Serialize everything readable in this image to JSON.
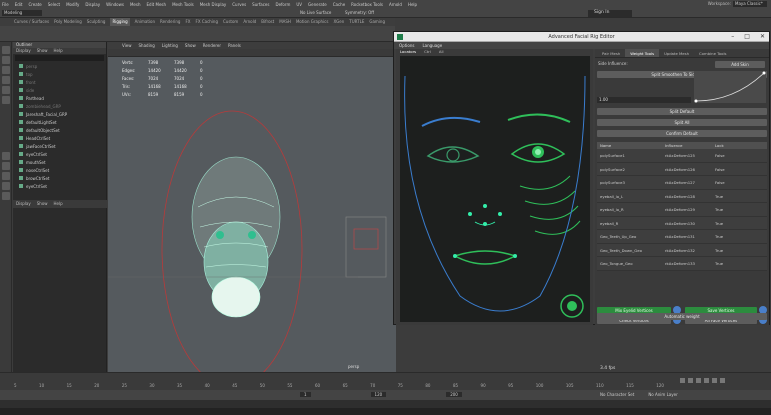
{
  "menubar": {
    "items": [
      "File",
      "Edit",
      "Create",
      "Select",
      "Modify",
      "Display",
      "Windows",
      "Mesh",
      "Edit Mesh",
      "Mesh Tools",
      "Mesh Display",
      "Curves",
      "Surfaces",
      "Deform",
      "UV",
      "Generate",
      "Cache",
      "Rocketbox Tools",
      "Arnold",
      "Help"
    ],
    "workspace_label": "Workspace:",
    "workspace_value": "Maya Classic*"
  },
  "statusline": {
    "mode": "Modeling",
    "sign_in": "Sign In",
    "live_surface": "No Live Surface",
    "symmetry": "Symmetry: Off"
  },
  "shelf_tabs": {
    "items": [
      "Curves / Surfaces",
      "Poly Modeling",
      "Sculpting",
      "Rigging",
      "Animation",
      "Rendering",
      "FX",
      "FX Caching",
      "Custom",
      "Arnold",
      "Bifrost",
      "MASH",
      "Motion Graphics",
      "XGen",
      "TURTLE",
      "Gaming"
    ],
    "active": 3
  },
  "outliner": {
    "title": "Outliner",
    "menu": [
      "Display",
      "Show",
      "Help"
    ],
    "items": [
      {
        "label": "persp",
        "dim": true
      },
      {
        "label": "top",
        "dim": true
      },
      {
        "label": "front",
        "dim": true
      },
      {
        "label": "side",
        "dim": true
      },
      {
        "label": "Parthead",
        "dim": false
      },
      {
        "label": "zombiehead_GRP",
        "dim": true
      },
      {
        "label": "Jareshaft_Facial_GRP",
        "dim": false
      },
      {
        "label": "defaultLightSet",
        "dim": false
      },
      {
        "label": "defaultObjectSet",
        "dim": false
      },
      {
        "label": "HeadCtrlSet",
        "dim": false
      },
      {
        "label": "jawFaceCtrlSet",
        "dim": false
      },
      {
        "label": "eyeCtrlSet",
        "dim": false
      },
      {
        "label": "mouthSet",
        "dim": false
      },
      {
        "label": "noseCtrlSet",
        "dim": false
      },
      {
        "label": "browCtrlSet",
        "dim": false
      },
      {
        "label": "eyeCtrlSet",
        "dim": false
      }
    ],
    "lower_menu": [
      "Display",
      "Show",
      "Help"
    ]
  },
  "viewport": {
    "menu": [
      "View",
      "Shading",
      "Lighting",
      "Show",
      "Renderer",
      "Panels"
    ],
    "hud": [
      [
        "Verts:",
        "7398",
        "7398",
        "0"
      ],
      [
        "Edges:",
        "14420",
        "14420",
        "0"
      ],
      [
        "Faces:",
        "7024",
        "7024",
        "0"
      ],
      [
        "Tris:",
        "14168",
        "14168",
        "0"
      ],
      [
        "UVs:",
        "8159",
        "8159",
        "0"
      ]
    ],
    "camera": "persp",
    "fps": "3.4 fps"
  },
  "timeline": {
    "ticks": [
      "5",
      "10",
      "15",
      "20",
      "25",
      "30",
      "35",
      "40",
      "45",
      "50",
      "55",
      "60",
      "65",
      "70",
      "75",
      "80",
      "85",
      "90",
      "95",
      "100",
      "105",
      "110",
      "115",
      "120"
    ],
    "start": "1",
    "end": "120",
    "range_end": "200",
    "no_character_set": "No Character Set",
    "no_anim_layer": "No Anim Layer"
  },
  "editor": {
    "title": "Advanced Facial Rig Editor",
    "menu": [
      "Options",
      "Language"
    ],
    "left_tabs": [
      "Locators",
      "Ctrl",
      "All"
    ],
    "left_tab_active": 0,
    "right_tabs": [
      "Pair Mesh",
      "Weight Tools",
      "Update Mesh",
      "Combine Tools"
    ],
    "right_tab_active": 1,
    "side_influence_label": "Side Influence:",
    "add_skin": "Add Skin",
    "smooth_btn": "Split Smoothen To Side Weight",
    "value_field": "1.00",
    "split_default": "Split Default",
    "split_all": "Split All",
    "confirm_default": "Confirm Default",
    "table_headers": [
      "Name",
      "Influence",
      "Lock"
    ],
    "table_rows": [
      [
        "polySurface1",
        "rkAxDeform125",
        "False"
      ],
      [
        "polySurface2",
        "rkAxDeform126",
        "False"
      ],
      [
        "polySurface3",
        "rkAxDeform127",
        "False"
      ],
      [
        "eyeball_lo_L",
        "rkAxDeform128",
        "True"
      ],
      [
        "eyeball_lo_R",
        "rkAxDeform129",
        "True"
      ],
      [
        "eyeball_R",
        "rkAxDeform130",
        "True"
      ],
      [
        "Geo_Teeth_Up_Geo",
        "rkAxDeform131",
        "True"
      ],
      [
        "Geo_Teeth_Down_Geo",
        "rkAxDeform132",
        "True"
      ],
      [
        "Geo_Tongue_Geo",
        "rkAxDeform133",
        "True"
      ]
    ],
    "mix_eyelid": "Mix Eyelid Vertices",
    "save_vertices": "Save Vertices",
    "check_vertices": "Check Vertices",
    "all_face": "All Face Vertices",
    "auto_weight": "Automatic weight"
  }
}
